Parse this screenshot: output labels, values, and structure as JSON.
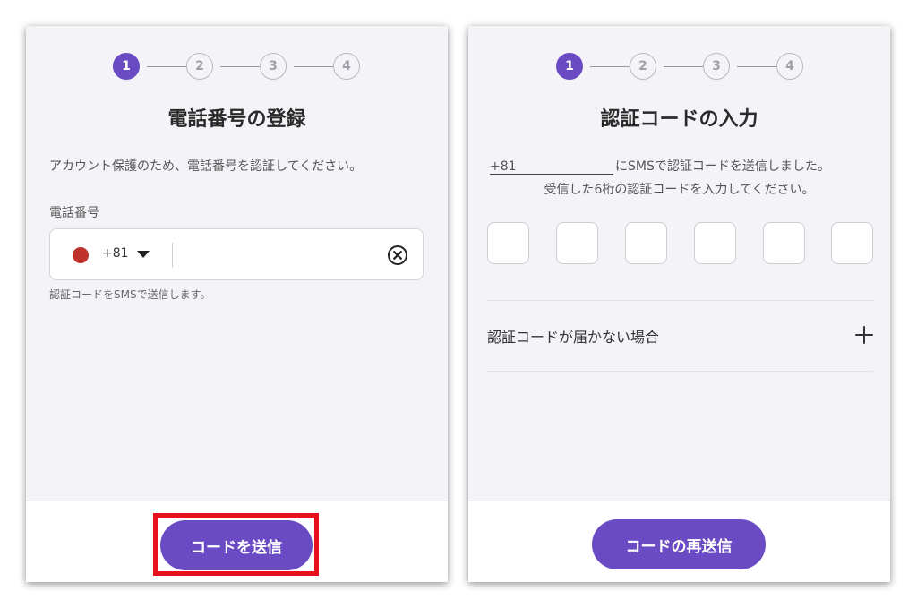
{
  "colors": {
    "accent": "#6a4bc4",
    "highlight": "#e8101a",
    "panel_bg": "#f4f4f8",
    "flag_red": "#c0322c"
  },
  "left_panel": {
    "steps": [
      "1",
      "2",
      "3",
      "4"
    ],
    "active_step": 1,
    "title": "電話番号の登録",
    "description": "アカウント保護のため、電話番号を認証してください。",
    "phone_label": "電話番号",
    "country_code": "+81",
    "phone_value": "",
    "phone_placeholder": "",
    "flag_icon": "japan-flag-icon",
    "dropdown_icon": "caret-down-icon",
    "clear_icon": "clear-circle-x-icon",
    "hint": "認証コードをSMSで送信します。",
    "submit_label": "コードを送信"
  },
  "right_panel": {
    "steps": [
      "1",
      "2",
      "3",
      "4"
    ],
    "active_step": 1,
    "title": "認証コードの入力",
    "sms_phone": "+81",
    "sms_line1_suffix": "にSMSで認証コードを送信しました。",
    "sms_line2": "受信した6桁の認証コードを入力してください。",
    "code_digits": [
      "",
      "",
      "",
      "",
      "",
      ""
    ],
    "accordion_label": "認証コードが届かない場合",
    "accordion_icon": "plus-icon",
    "resend_label": "コードの再送信"
  }
}
